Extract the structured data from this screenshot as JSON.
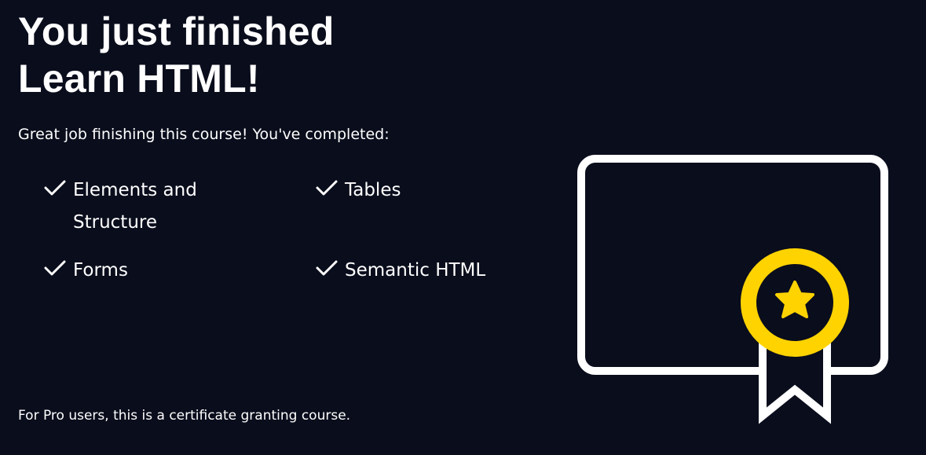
{
  "heading": {
    "line1": "You just finished",
    "line2": "Learn HTML!"
  },
  "intro": "Great job finishing this course! You've completed:",
  "completed_items": [
    {
      "label": "Elements and Structure",
      "icon": "checkmark-icon"
    },
    {
      "label": "Tables",
      "icon": "checkmark-icon"
    },
    {
      "label": "Forms",
      "icon": "checkmark-icon"
    },
    {
      "label": "Semantic HTML",
      "icon": "checkmark-icon"
    }
  ],
  "footer_note": "For Pro users, this is a certificate granting course.",
  "illustration": {
    "icon": "certificate-badge-icon",
    "colors": {
      "background": "#0a0d1c",
      "outline": "#ffffff",
      "badge": "#ffd300",
      "star": "#ffd300"
    }
  }
}
